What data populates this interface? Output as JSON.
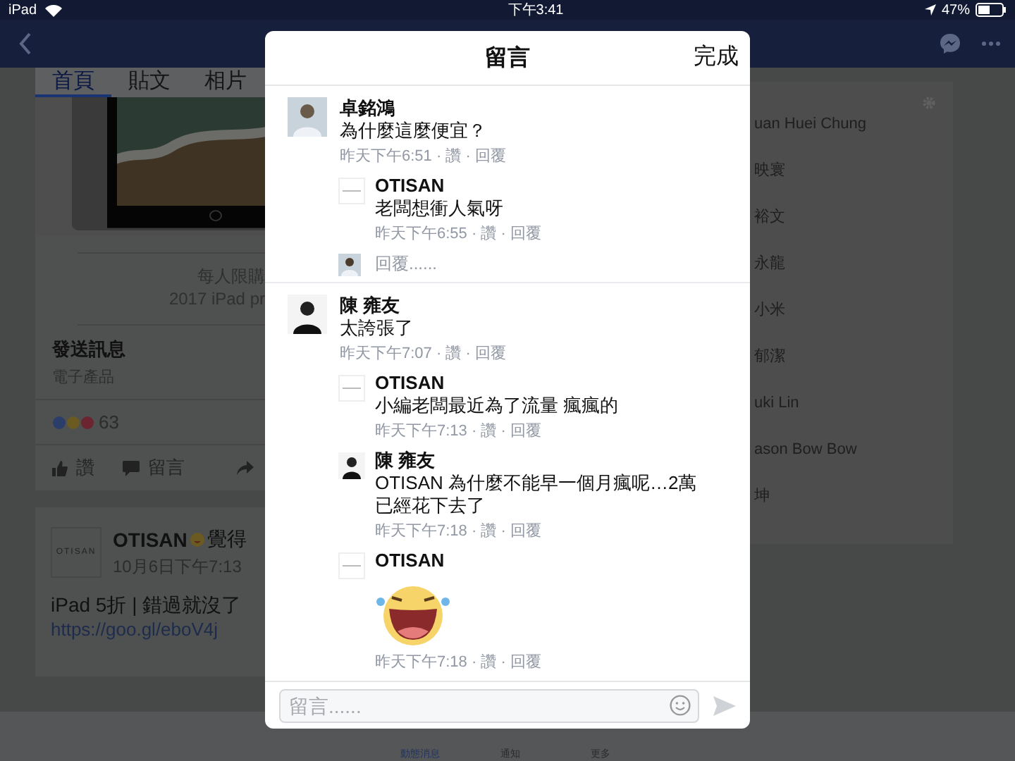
{
  "status_bar": {
    "carrier": "iPad",
    "time": "下午3:41",
    "battery": "47%"
  },
  "page_tabs": [
    {
      "label": "首頁",
      "selected": true
    },
    {
      "label": "貼文",
      "selected": false
    },
    {
      "label": "相片",
      "selected": false
    }
  ],
  "link_preview": {
    "caption_1": "每人限購",
    "caption_2": "2017 iPad pr"
  },
  "page_info": {
    "title": "發送訊息",
    "category": "電子產品",
    "reaction_count": "63",
    "actions": [
      "讚",
      "留言"
    ]
  },
  "post": {
    "logo_text": "OTISAN",
    "author": "OTISAN",
    "feeling": "覺得",
    "date": "10月6日下午7:13",
    "text": "iPad 5折 | 錯過就沒了",
    "link": "https://goo.gl/eboV4j"
  },
  "friends_panel": {
    "names": [
      "uan Huei Chung",
      "映寰",
      "裕文",
      "永龍",
      "小米",
      "郁潔",
      "uki Lin",
      "ason Bow Bow",
      "坤"
    ]
  },
  "bottom_tabs": [
    {
      "label": "動態消息",
      "selected": true
    },
    {
      "label": "通知",
      "selected": false
    },
    {
      "label": "更多",
      "selected": false
    }
  ],
  "comments_dialog": {
    "title": "留言",
    "done": "完成",
    "comments": [
      {
        "page_avatar": false,
        "name": "卓銘鴻",
        "text": "為什麼這麼便宜？",
        "meta": "昨天下午6:51 · 讚 · 回覆",
        "reply_prompt": "回覆......",
        "replies": [
          {
            "page_avatar": true,
            "name": "OTISAN",
            "kind": "text",
            "text": "老闆想衝人氣呀",
            "meta": "昨天下午6:55 · 讚 · 回覆"
          }
        ]
      },
      {
        "page_avatar": false,
        "name": "陳 雍友",
        "text": "太誇張了",
        "meta": "昨天下午7:07 · 讚 · 回覆",
        "replies": [
          {
            "page_avatar": true,
            "name": "OTISAN",
            "kind": "text",
            "text": "小編老闆最近為了流量 瘋瘋的",
            "meta": "昨天下午7:13 · 讚 · 回覆"
          },
          {
            "page_avatar": false,
            "name": "陳 雍友",
            "kind": "text",
            "text": "OTISAN 為什麼不能早一個月瘋呢…2萬已經花下去了",
            "meta": "昨天下午7:18 · 讚 · 回覆"
          },
          {
            "page_avatar": true,
            "name": "OTISAN",
            "kind": "sticker",
            "meta": "昨天下午7:18 · 讚 · 回覆"
          }
        ]
      }
    ],
    "input": {
      "placeholder": "留言......"
    }
  }
}
